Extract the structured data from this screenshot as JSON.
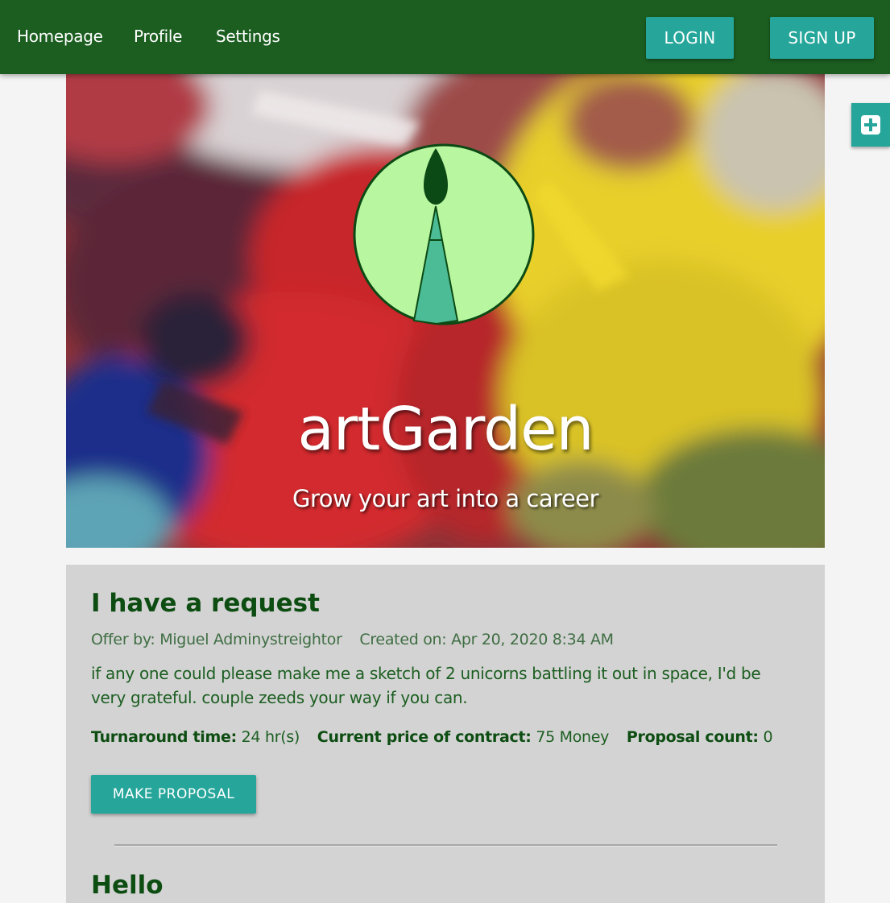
{
  "nav": {
    "links": [
      "Homepage",
      "Profile",
      "Settings"
    ],
    "login_label": "LOGIN",
    "signup_label": "SIGN UP"
  },
  "fab": {
    "icon": "plus-square-icon"
  },
  "hero": {
    "logo_icon": "paintbrush-logo-icon",
    "title": "artGarden",
    "subtitle": "Grow your art into a career"
  },
  "request": {
    "title": "I have a request",
    "offer_by": "Offer by: Miguel Adminystreightor",
    "created_on": "Created on: Apr 20, 2020 8:34 AM",
    "description": "if any one could please make me a sketch of 2 unicorns battling it out in space, I'd be very grateful. couple zeeds your way if you can.",
    "turnaround_label": "Turnaround time:",
    "turnaround_value": "24 hr(s)",
    "price_label": "Current price of contract:",
    "price_value": "75 Money",
    "proposal_label": "Proposal count:",
    "proposal_value": "0",
    "button_label": "MAKE PROPOSAL"
  },
  "next_request": {
    "title": "Hello"
  },
  "colors": {
    "navbar": "#1b5e20",
    "accent": "#26a69a",
    "title_text": "#0d4d12",
    "card_bg": "#d3d3d3",
    "logo_fill": "#b9f6a0"
  }
}
